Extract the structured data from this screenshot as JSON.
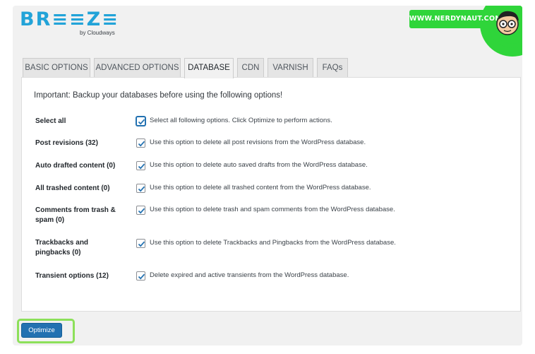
{
  "logo": {
    "wordmark": "BR≡≡Z≡",
    "byline": "by Cloudways"
  },
  "watermark": {
    "text": "WWW.NERDYNAUT.COM"
  },
  "tabs": [
    {
      "label": "BASIC OPTIONS",
      "active": false
    },
    {
      "label": "ADVANCED OPTIONS",
      "active": false
    },
    {
      "label": "DATABASE",
      "active": true
    },
    {
      "label": "CDN",
      "active": false
    },
    {
      "label": "VARNISH",
      "active": false
    },
    {
      "label": "FAQs",
      "active": false
    }
  ],
  "notice": "Important: Backup your databases before using the following options!",
  "options": [
    {
      "label": "Select all",
      "checked": true,
      "description": "Select all following options. Click Optimize to perform actions."
    },
    {
      "label": "Post revisions (32)",
      "checked": true,
      "description": "Use this option to delete all post revisions from the WordPress database."
    },
    {
      "label": "Auto drafted content (0)",
      "checked": true,
      "description": "Use this option to delete auto saved drafts from the WordPress database."
    },
    {
      "label": "All trashed content (0)",
      "checked": true,
      "description": "Use this option to delete all trashed content from the WordPress database."
    },
    {
      "label": "Comments from trash & spam (0)",
      "checked": true,
      "description": "Use this option to delete trash and spam comments from the WordPress database."
    },
    {
      "label": "Trackbacks and pingbacks (0)",
      "checked": true,
      "description": "Use this option to delete Trackbacks and Pingbacks from the WordPress database."
    },
    {
      "label": "Transient options (12)",
      "checked": true,
      "description": "Delete expired and active transients from the WordPress database."
    }
  ],
  "optimize_button": "Optimize",
  "colors": {
    "brand": "#22a3d8",
    "primary_button": "#2271b1",
    "highlight": "#8de05a",
    "badge": "#2fd53a"
  }
}
